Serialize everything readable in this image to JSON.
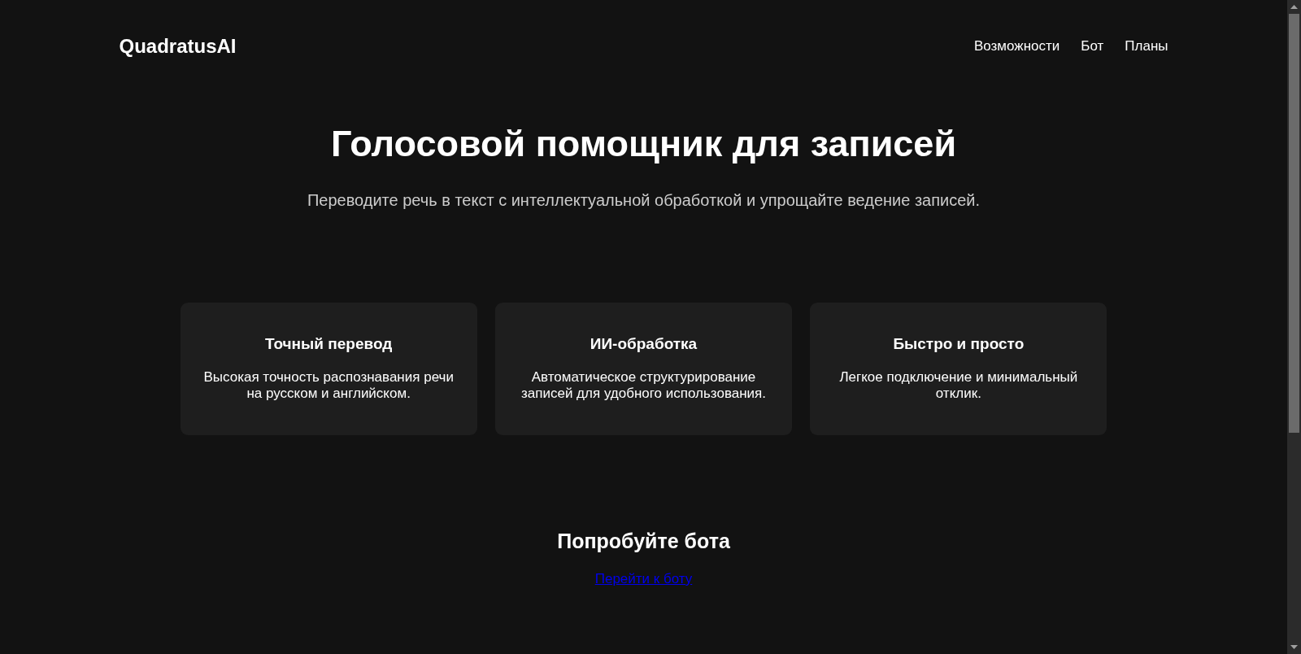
{
  "header": {
    "logo": "QuadratusAI",
    "nav": [
      {
        "label": "Возможности"
      },
      {
        "label": "Бот"
      },
      {
        "label": "Планы"
      }
    ]
  },
  "hero": {
    "title": "Голосовой помощник для записей",
    "subtitle": "Переводите речь в текст с интеллектуальной обработкой и упрощайте ведение записей."
  },
  "features": [
    {
      "title": "Точный перевод",
      "text": "Высокая точность распознавания речи на русском и английском."
    },
    {
      "title": "ИИ-обработка",
      "text": "Автоматическое структурирование записей для удобного использования."
    },
    {
      "title": "Быстро и просто",
      "text": "Легкое подключение и минимальный отклик."
    }
  ],
  "cta": {
    "title": "Попробуйте бота",
    "link": "Перейти к боту"
  }
}
